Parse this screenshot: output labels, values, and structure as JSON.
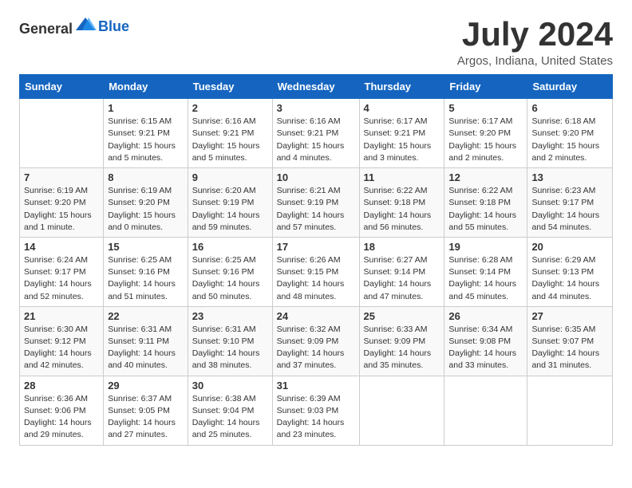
{
  "header": {
    "logo_general": "General",
    "logo_blue": "Blue",
    "title": "July 2024",
    "subtitle": "Argos, Indiana, United States"
  },
  "columns": [
    "Sunday",
    "Monday",
    "Tuesday",
    "Wednesday",
    "Thursday",
    "Friday",
    "Saturday"
  ],
  "weeks": [
    [
      {
        "day": "",
        "info": ""
      },
      {
        "day": "1",
        "info": "Sunrise: 6:15 AM\nSunset: 9:21 PM\nDaylight: 15 hours\nand 5 minutes."
      },
      {
        "day": "2",
        "info": "Sunrise: 6:16 AM\nSunset: 9:21 PM\nDaylight: 15 hours\nand 5 minutes."
      },
      {
        "day": "3",
        "info": "Sunrise: 6:16 AM\nSunset: 9:21 PM\nDaylight: 15 hours\nand 4 minutes."
      },
      {
        "day": "4",
        "info": "Sunrise: 6:17 AM\nSunset: 9:21 PM\nDaylight: 15 hours\nand 3 minutes."
      },
      {
        "day": "5",
        "info": "Sunrise: 6:17 AM\nSunset: 9:20 PM\nDaylight: 15 hours\nand 2 minutes."
      },
      {
        "day": "6",
        "info": "Sunrise: 6:18 AM\nSunset: 9:20 PM\nDaylight: 15 hours\nand 2 minutes."
      }
    ],
    [
      {
        "day": "7",
        "info": "Sunrise: 6:19 AM\nSunset: 9:20 PM\nDaylight: 15 hours\nand 1 minute."
      },
      {
        "day": "8",
        "info": "Sunrise: 6:19 AM\nSunset: 9:20 PM\nDaylight: 15 hours\nand 0 minutes."
      },
      {
        "day": "9",
        "info": "Sunrise: 6:20 AM\nSunset: 9:19 PM\nDaylight: 14 hours\nand 59 minutes."
      },
      {
        "day": "10",
        "info": "Sunrise: 6:21 AM\nSunset: 9:19 PM\nDaylight: 14 hours\nand 57 minutes."
      },
      {
        "day": "11",
        "info": "Sunrise: 6:22 AM\nSunset: 9:18 PM\nDaylight: 14 hours\nand 56 minutes."
      },
      {
        "day": "12",
        "info": "Sunrise: 6:22 AM\nSunset: 9:18 PM\nDaylight: 14 hours\nand 55 minutes."
      },
      {
        "day": "13",
        "info": "Sunrise: 6:23 AM\nSunset: 9:17 PM\nDaylight: 14 hours\nand 54 minutes."
      }
    ],
    [
      {
        "day": "14",
        "info": "Sunrise: 6:24 AM\nSunset: 9:17 PM\nDaylight: 14 hours\nand 52 minutes."
      },
      {
        "day": "15",
        "info": "Sunrise: 6:25 AM\nSunset: 9:16 PM\nDaylight: 14 hours\nand 51 minutes."
      },
      {
        "day": "16",
        "info": "Sunrise: 6:25 AM\nSunset: 9:16 PM\nDaylight: 14 hours\nand 50 minutes."
      },
      {
        "day": "17",
        "info": "Sunrise: 6:26 AM\nSunset: 9:15 PM\nDaylight: 14 hours\nand 48 minutes."
      },
      {
        "day": "18",
        "info": "Sunrise: 6:27 AM\nSunset: 9:14 PM\nDaylight: 14 hours\nand 47 minutes."
      },
      {
        "day": "19",
        "info": "Sunrise: 6:28 AM\nSunset: 9:14 PM\nDaylight: 14 hours\nand 45 minutes."
      },
      {
        "day": "20",
        "info": "Sunrise: 6:29 AM\nSunset: 9:13 PM\nDaylight: 14 hours\nand 44 minutes."
      }
    ],
    [
      {
        "day": "21",
        "info": "Sunrise: 6:30 AM\nSunset: 9:12 PM\nDaylight: 14 hours\nand 42 minutes."
      },
      {
        "day": "22",
        "info": "Sunrise: 6:31 AM\nSunset: 9:11 PM\nDaylight: 14 hours\nand 40 minutes."
      },
      {
        "day": "23",
        "info": "Sunrise: 6:31 AM\nSunset: 9:10 PM\nDaylight: 14 hours\nand 38 minutes."
      },
      {
        "day": "24",
        "info": "Sunrise: 6:32 AM\nSunset: 9:09 PM\nDaylight: 14 hours\nand 37 minutes."
      },
      {
        "day": "25",
        "info": "Sunrise: 6:33 AM\nSunset: 9:09 PM\nDaylight: 14 hours\nand 35 minutes."
      },
      {
        "day": "26",
        "info": "Sunrise: 6:34 AM\nSunset: 9:08 PM\nDaylight: 14 hours\nand 33 minutes."
      },
      {
        "day": "27",
        "info": "Sunrise: 6:35 AM\nSunset: 9:07 PM\nDaylight: 14 hours\nand 31 minutes."
      }
    ],
    [
      {
        "day": "28",
        "info": "Sunrise: 6:36 AM\nSunset: 9:06 PM\nDaylight: 14 hours\nand 29 minutes."
      },
      {
        "day": "29",
        "info": "Sunrise: 6:37 AM\nSunset: 9:05 PM\nDaylight: 14 hours\nand 27 minutes."
      },
      {
        "day": "30",
        "info": "Sunrise: 6:38 AM\nSunset: 9:04 PM\nDaylight: 14 hours\nand 25 minutes."
      },
      {
        "day": "31",
        "info": "Sunrise: 6:39 AM\nSunset: 9:03 PM\nDaylight: 14 hours\nand 23 minutes."
      },
      {
        "day": "",
        "info": ""
      },
      {
        "day": "",
        "info": ""
      },
      {
        "day": "",
        "info": ""
      }
    ]
  ]
}
